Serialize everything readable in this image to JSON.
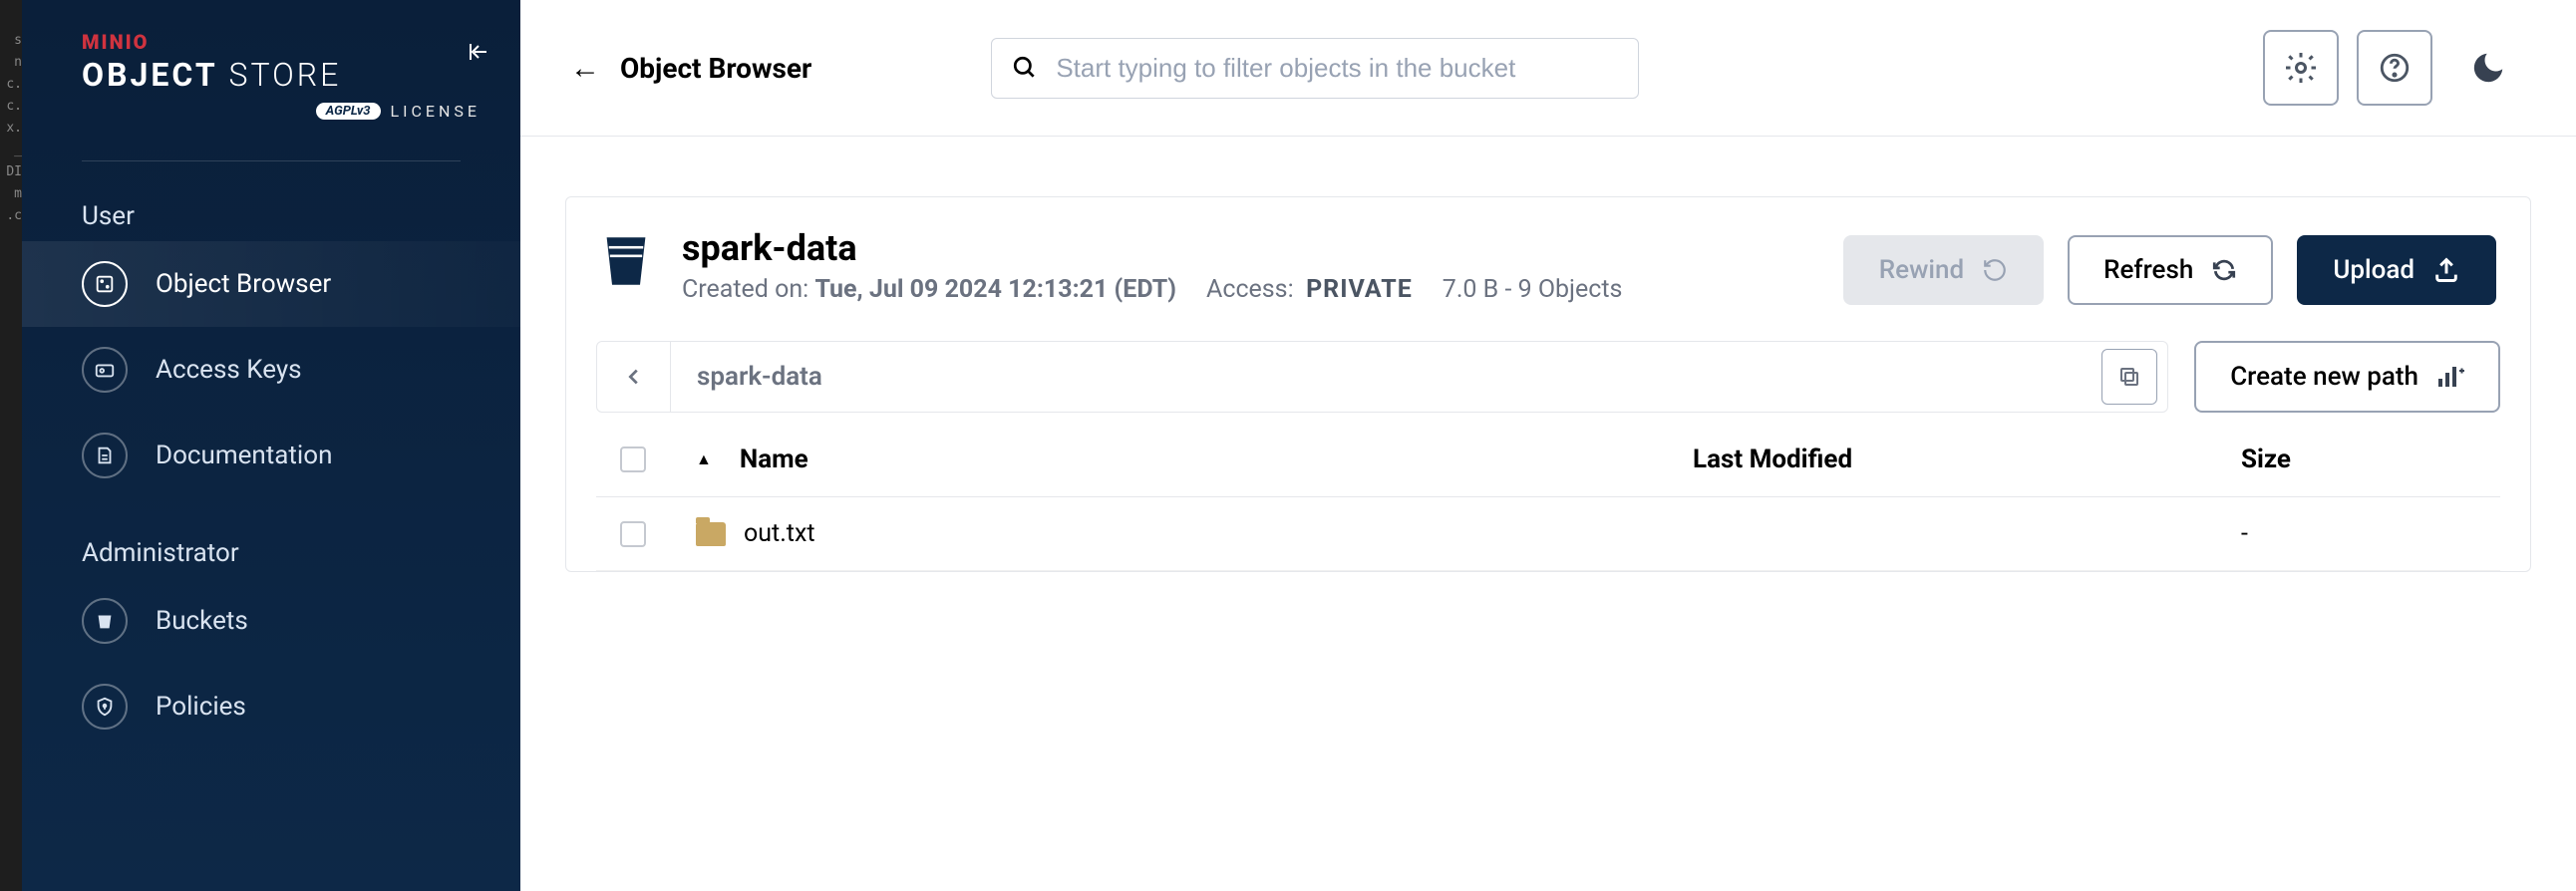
{
  "brand": {
    "top": "MINIO",
    "main_a": "OBJECT",
    "main_b": "STORE",
    "badge": "AGPLv3",
    "license": "LICENSE"
  },
  "sidebar": {
    "sections": [
      {
        "title": "User",
        "items": [
          {
            "label": "Object Browser"
          },
          {
            "label": "Access Keys"
          },
          {
            "label": "Documentation"
          }
        ]
      },
      {
        "title": "Administrator",
        "items": [
          {
            "label": "Buckets"
          },
          {
            "label": "Policies"
          }
        ]
      }
    ]
  },
  "header": {
    "back_label": "Object Browser",
    "search_placeholder": "Start typing to filter objects in the bucket"
  },
  "bucket": {
    "name": "spark-data",
    "created_label": "Created on:",
    "created_value": "Tue, Jul 09 2024 12:13:21 (EDT)",
    "access_label": "Access:",
    "access_value": "PRIVATE",
    "size_summary": "7.0 B - 9 Objects",
    "rewind": "Rewind",
    "refresh": "Refresh",
    "upload": "Upload",
    "path": "spark-data",
    "create_path": "Create new path"
  },
  "table": {
    "cols": {
      "name": "Name",
      "modified": "Last Modified",
      "size": "Size"
    },
    "rows": [
      {
        "name": "out.txt",
        "modified": "",
        "size": "-"
      }
    ]
  }
}
